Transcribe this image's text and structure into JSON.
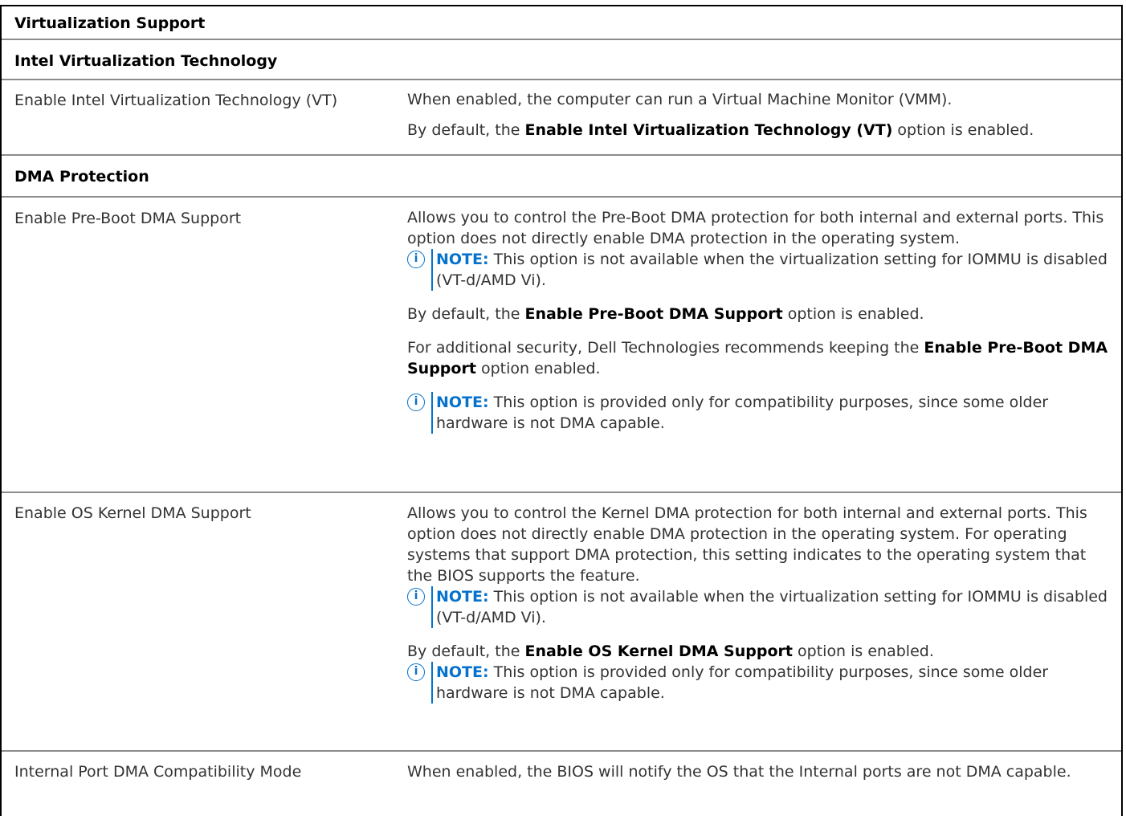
{
  "header": {
    "title": "Virtualization Support"
  },
  "sections": [
    {
      "title": "Intel Virtualization Technology",
      "rows": [
        {
          "setting": "Enable Intel Virtualization Technology (VT)",
          "desc1": "When enabled, the computer can run a Virtual Machine Monitor (VMM).",
          "default_prefix": "By default, the ",
          "default_bold": "Enable Intel Virtualization Technology (VT)",
          "default_suffix": " option is enabled."
        }
      ]
    },
    {
      "title": "DMA Protection",
      "rows": [
        {
          "setting": "Enable Pre-Boot DMA Support",
          "desc1": "Allows you to control the Pre-Boot DMA protection for both internal and external ports. This option does not directly enable DMA protection in the operating system.",
          "note1_label": "NOTE:",
          "note1_text": " This option is not available when the virtualization setting for IOMMU is disabled (VT-d/AMD Vi).",
          "default_prefix": "By default, the ",
          "default_bold": "Enable Pre-Boot DMA Support",
          "default_suffix": " option is enabled.",
          "rec_prefix": "For additional security, Dell Technologies recommends keeping the ",
          "rec_bold": "Enable Pre-Boot DMA Support",
          "rec_suffix": " option enabled.",
          "note2_label": "NOTE:",
          "note2_text": " This option is provided only for compatibility purposes, since some older hardware is not DMA capable."
        },
        {
          "setting": "Enable OS Kernel DMA Support",
          "desc1": "Allows you to control the Kernel DMA protection for both internal and external ports. This option does not directly enable DMA protection in the operating system. For operating systems that support DMA protection, this setting indicates to the operating system that the BIOS supports the feature.",
          "note1_label": "NOTE:",
          "note1_text": " This option is not available when the virtualization setting for IOMMU is disabled (VT-d/AMD Vi).",
          "default_prefix": "By default, the ",
          "default_bold": "Enable OS Kernel DMA Support",
          "default_suffix": " option is enabled.",
          "note2_label": "NOTE:",
          "note2_text": " This option is provided only for compatibility purposes, since some older hardware is not DMA capable."
        },
        {
          "setting": "Internal Port DMA Compatibility Mode",
          "desc1": "When enabled, the BIOS will notify the OS that the Internal ports are not DMA capable."
        }
      ]
    }
  ],
  "icons": {
    "note": "info-icon",
    "note_glyph": "i",
    "accent": "#0672cb"
  }
}
